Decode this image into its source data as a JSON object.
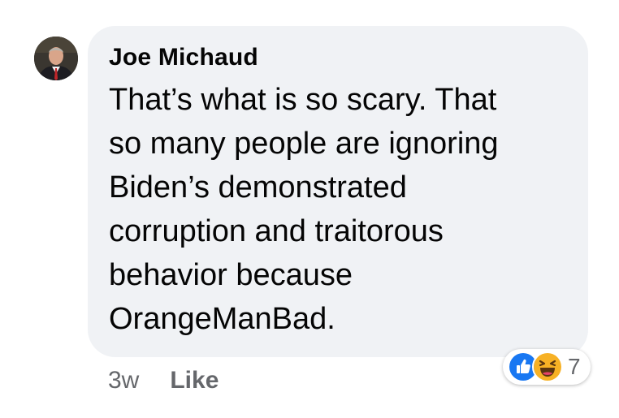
{
  "comment": {
    "author": "Joe Michaud",
    "text_lines": [
      "That’s what is so scary. That",
      "so many people are ignoring",
      "Biden’s demonstrated",
      "corruption and traitorous",
      "behavior because",
      "OrangeManBad."
    ],
    "timestamp": "3w",
    "like_label": "Like",
    "reactions": {
      "icons": [
        "like-reaction-icon",
        "haha-reaction-icon"
      ],
      "count": "7"
    }
  },
  "colors": {
    "bubble_background": "#f0f2f5",
    "text": "#050505",
    "secondary_text": "#65676b",
    "like_blue": "#1877f2",
    "haha_yellow": "#f7b125"
  }
}
